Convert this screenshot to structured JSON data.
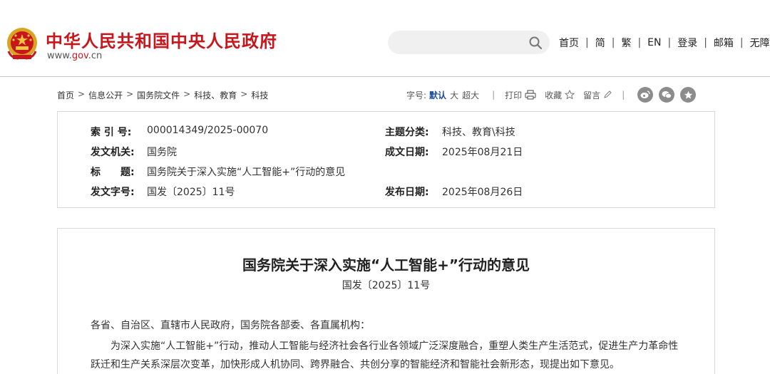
{
  "header": {
    "site_title": "中华人民共和国中央人民政府",
    "site_url_prefix": "www.",
    "site_url_gov": "gov",
    "site_url_suffix": ".cn",
    "search_placeholder": "",
    "nav": [
      "首页",
      "简",
      "繁",
      "EN",
      "登录",
      "邮箱",
      "无障碍"
    ],
    "nav_separator": "|"
  },
  "breadcrumb": {
    "items": [
      "首页",
      "信息公开",
      "国务院文件",
      "科技、教育",
      "科技"
    ],
    "separator": ">"
  },
  "toolbar": {
    "font_label": "字号:",
    "font_default": "默认",
    "font_large": "大",
    "font_xlarge": "超大",
    "separator": "|",
    "print": "打印",
    "favorite": "收藏",
    "comment": "留言",
    "end_separator": "|",
    "social_icons": [
      "weibo-icon",
      "wechat-icon",
      "star-icon"
    ]
  },
  "info": {
    "index_label": "索 引 号:",
    "index_value": "000014349/2025-00070",
    "topic_label": "主题分类:",
    "topic_value": "科技、教育\\科技",
    "issuer_label": "发文机关:",
    "issuer_value": "国务院",
    "date_written_label": "成文日期:",
    "date_written_value": "2025年08月21日",
    "title_label_a": "标",
    "title_label_b": "题:",
    "title_value": "国务院关于深入实施“人工智能+”行动的意见",
    "docno_label": "发文字号:",
    "docno_value": "国发〔2025〕11号",
    "date_published_label": "发布日期:",
    "date_published_value": "2025年08月26日"
  },
  "article": {
    "title": "国务院关于深入实施“人工智能+”行动的意见",
    "doc_number": "国发〔2025〕11号",
    "salutation": "各省、自治区、直辖市人民政府，国务院各部委、各直属机构：",
    "para1_line1": "为深入实施“人工智能+”行动，推动人工智能与经济社会各行业各领域广泛深度融合，重塑人类生产生活范式，促进生产力革命性",
    "para1_line2": "跃迁和生产关系深层次变革，加快形成人机协同、跨界融合、共创分享的智能经济和智能社会新形态，现提出如下意见。"
  },
  "colors": {
    "brand_red": "#c8161d",
    "active_blue": "#1a4e9c",
    "border": "#d9d9d9"
  }
}
